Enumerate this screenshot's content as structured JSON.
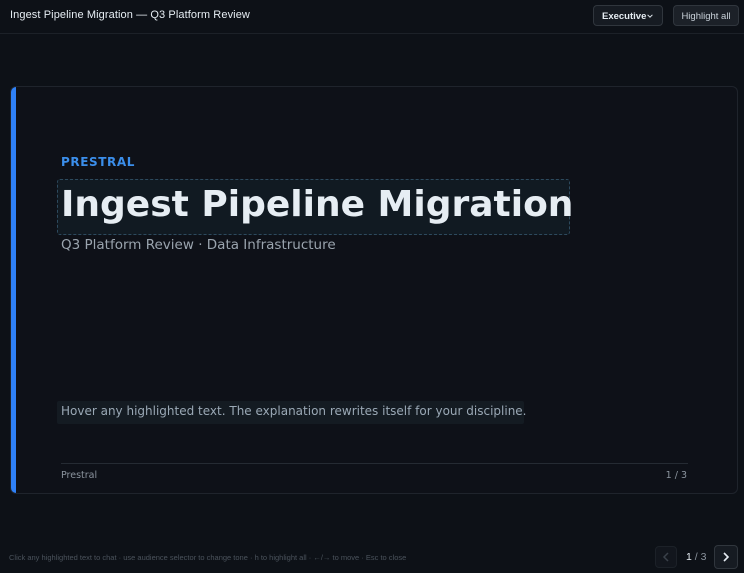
{
  "header": {
    "title": "Ingest Pipeline Migration — Q3 Platform Review",
    "audience_selected": "Executive",
    "highlight_all_label": "Highlight all"
  },
  "slide": {
    "brand": "PRESTRAL",
    "title": "Ingest Pipeline Migration",
    "subtitle": "Q3 Platform Review · Data Infrastructure",
    "hint": "Hover any highlighted text. The explanation rewrites itself for your discipline.",
    "footer_left": "Prestral",
    "footer_right": "1 / 3"
  },
  "footer": {
    "help": "Click any highlighted text to chat · use audience selector to change tone · h to highlight all · ←/→ to move · Esc to close",
    "current_page": "1",
    "total_pages": "3"
  },
  "icons": {
    "audience_chevron": "chevron-down-icon",
    "prev": "chevron-left-icon",
    "next": "chevron-right-icon"
  },
  "colors": {
    "background": "#0d1117",
    "accent": "#2f81f7",
    "brand": "#3b8eea"
  }
}
